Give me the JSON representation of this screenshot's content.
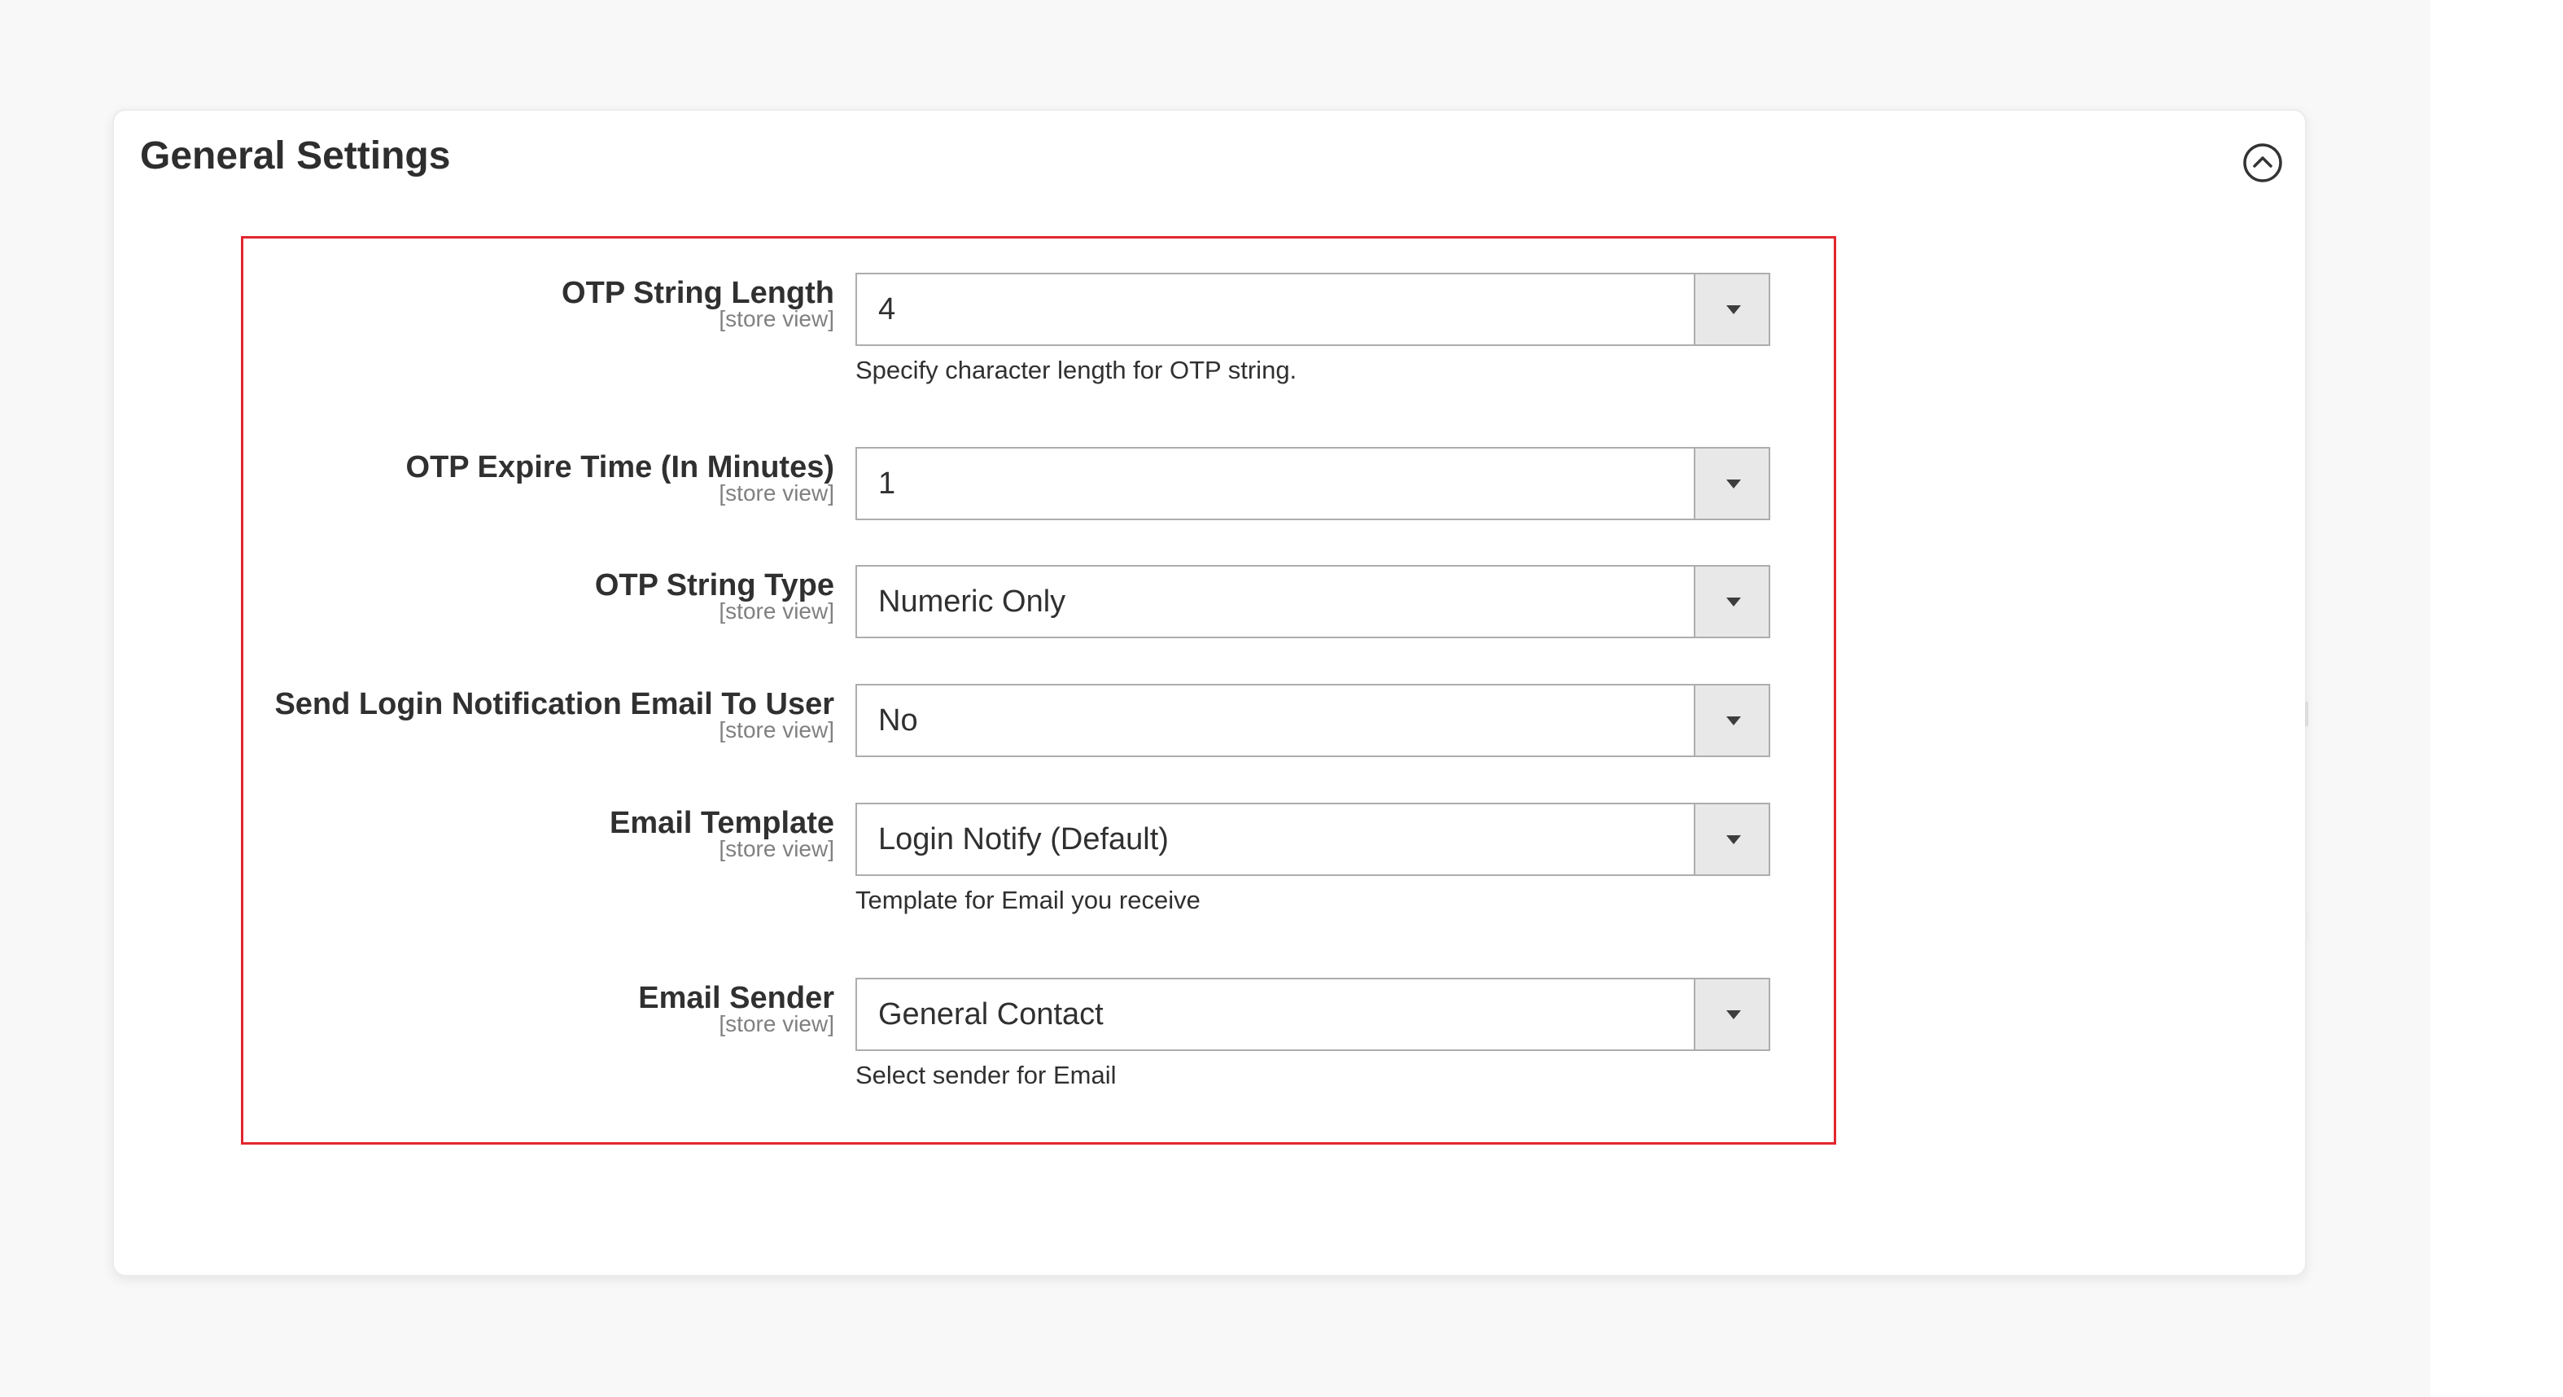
{
  "section": {
    "title": "General Settings",
    "collapse_icon": "chevron-up-circle-icon"
  },
  "highlight_color": "#e3262f",
  "fields": [
    {
      "label": "OTP String Length",
      "scope": "[store view]",
      "value": "4",
      "note": "Specify character length for OTP string."
    },
    {
      "label": "OTP Expire Time (In Minutes)",
      "scope": "[store view]",
      "value": "1",
      "note": ""
    },
    {
      "label": "OTP String Type",
      "scope": "[store view]",
      "value": "Numeric Only",
      "note": ""
    },
    {
      "label": "Send Login Notification Email To User",
      "scope": "[store view]",
      "value": "No",
      "note": ""
    },
    {
      "label": "Email Template",
      "scope": "[store view]",
      "value": "Login Notify (Default)",
      "note": "Template for Email you receive"
    },
    {
      "label": "Email Sender",
      "scope": "[store view]",
      "value": "General Contact",
      "note": "Select sender for Email"
    }
  ]
}
